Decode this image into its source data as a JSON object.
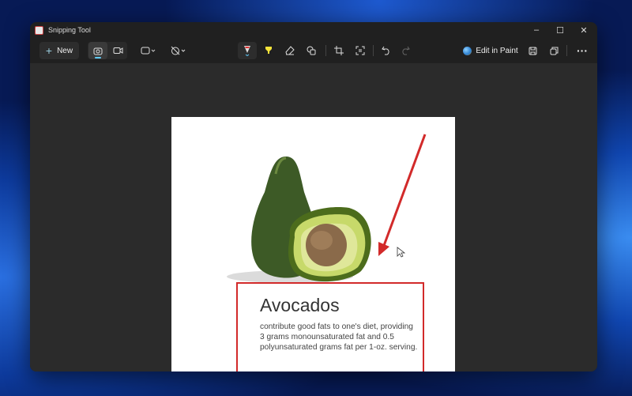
{
  "window": {
    "title": "Snipping Tool",
    "minimize": "–",
    "maximize": "☐",
    "close": "✕"
  },
  "toolbar": {
    "new_label": "New",
    "new_icon": "+",
    "edit_in_paint": "Edit in Paint",
    "more": "···"
  },
  "screenshot": {
    "heading": "Avocados",
    "body": "contribute good fats to one's diet, providing 3 grams monounsaturated fat and 0.5 polyunsaturated grams fat per 1-oz. serving."
  },
  "colors": {
    "accent": "#60cdff",
    "annotation": "#d22a2a"
  }
}
